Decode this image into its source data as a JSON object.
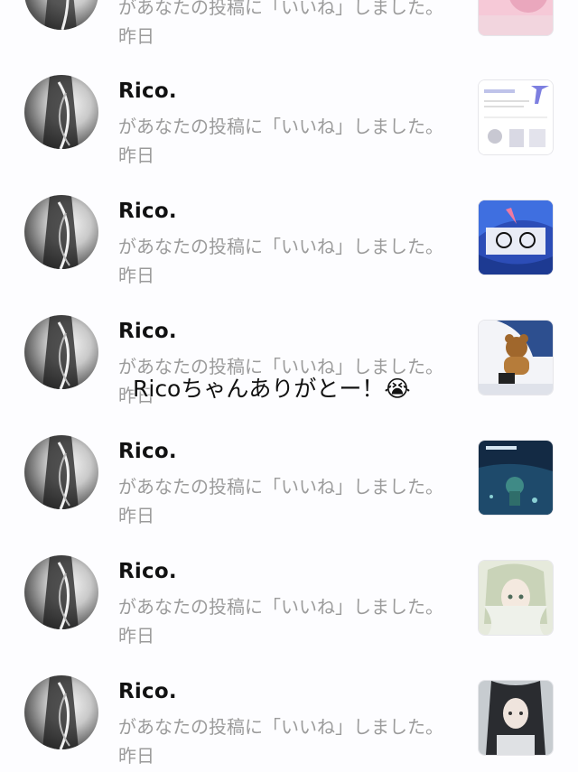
{
  "notifications": [
    {
      "name": "",
      "action": "があなたの投稿に「いいね」しました。",
      "time": "昨日",
      "thumb": "pink-image"
    },
    {
      "name": "Rico.",
      "action": "があなたの投稿に「いいね」しました。",
      "time": "昨日",
      "thumb": "app-screenshot"
    },
    {
      "name": "Rico.",
      "action": "があなたの投稿に「いいね」しました。",
      "time": "昨日",
      "thumb": "blue-hair-drawing"
    },
    {
      "name": "Rico.",
      "action": "があなたの投稿に「いいね」しました。",
      "time": "昨日",
      "thumb": "teddy-bear-photo"
    },
    {
      "name": "Rico.",
      "action": "があなたの投稿に「いいね」しました。",
      "time": "昨日",
      "thumb": "dark-blue-illustration"
    },
    {
      "name": "Rico.",
      "action": "があなたの投稿に「いいね」しました。",
      "time": "昨日",
      "thumb": "anime-girl-pastel"
    },
    {
      "name": "Rico.",
      "action": "があなたの投稿に「いいね」しました。",
      "time": "昨日",
      "thumb": "dark-hair-girl"
    }
  ],
  "overlay": {
    "caption": "Ricoちゃんありがとー！😭"
  },
  "colors": {
    "background": "#fdfdff",
    "name_text": "#111111",
    "secondary_text": "#9b9b9b"
  }
}
